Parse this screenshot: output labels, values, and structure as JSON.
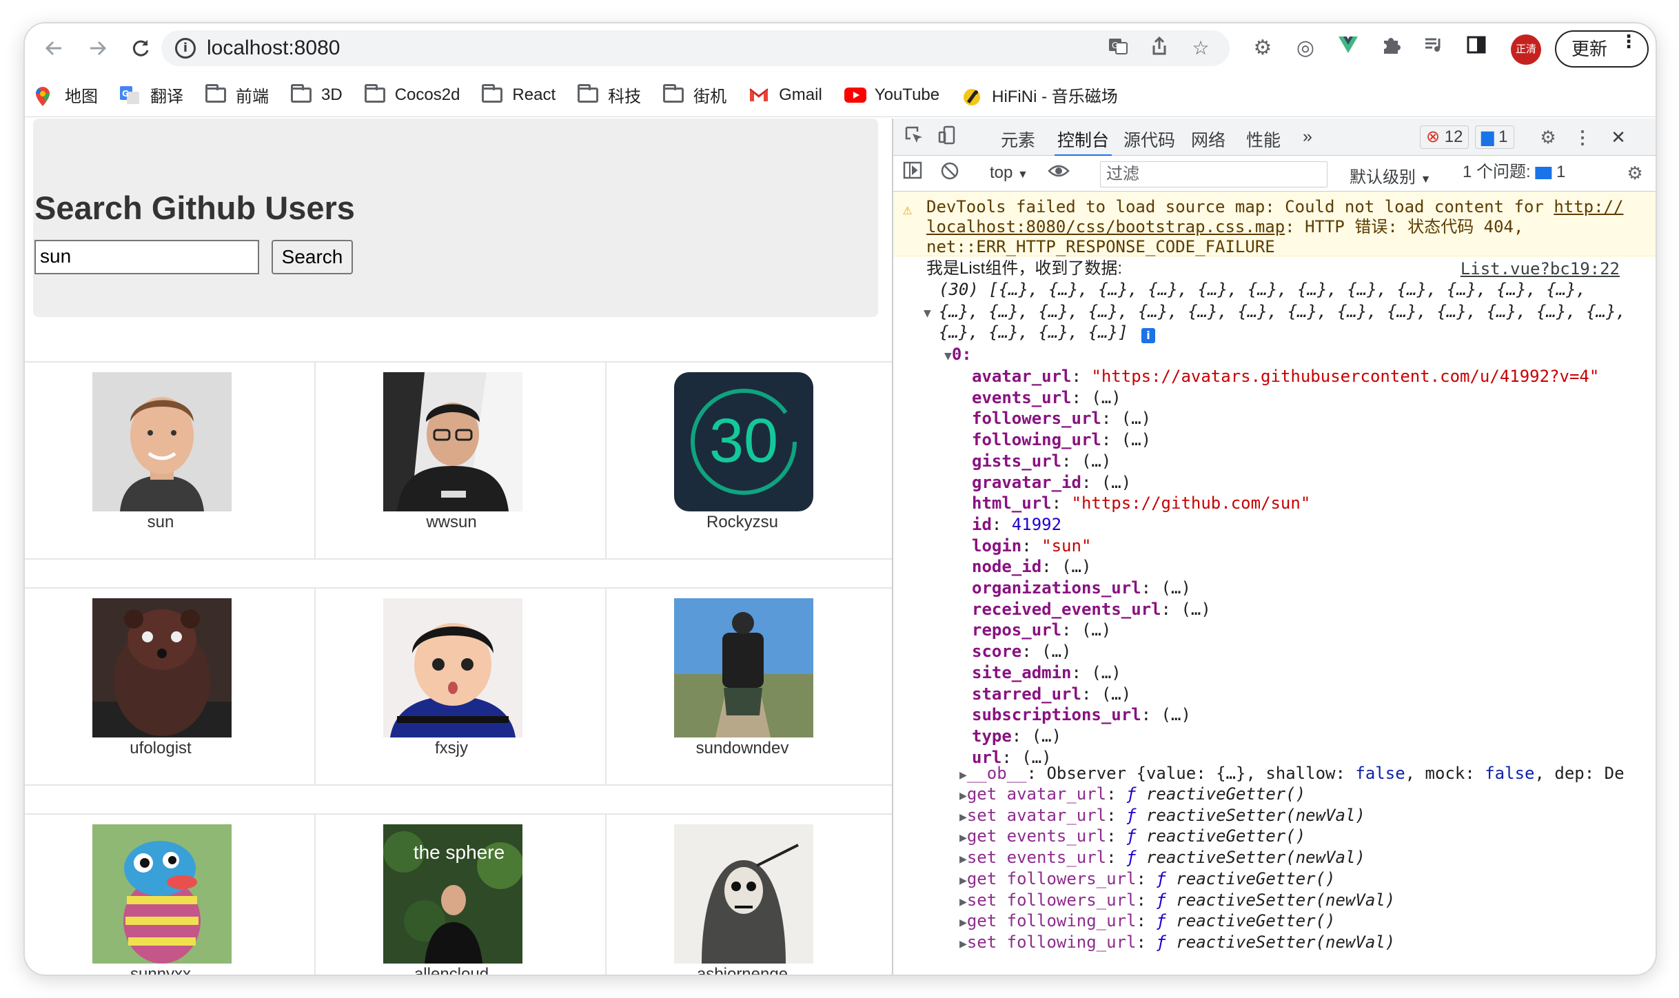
{
  "browser": {
    "url": "localhost:8080",
    "profile_label": "正清",
    "update_label": "更新"
  },
  "bookmarks": [
    {
      "label": "地图",
      "icon": "maps-icon"
    },
    {
      "label": "翻译",
      "icon": "translate-icon"
    },
    {
      "label": "前端",
      "icon": "folder-icon"
    },
    {
      "label": "3D",
      "icon": "folder-icon"
    },
    {
      "label": "Cocos2d",
      "icon": "folder-icon"
    },
    {
      "label": "React",
      "icon": "folder-icon"
    },
    {
      "label": "科技",
      "icon": "folder-icon"
    },
    {
      "label": "街机",
      "icon": "folder-icon"
    },
    {
      "label": "Gmail",
      "icon": "gmail-icon"
    },
    {
      "label": "YouTube",
      "icon": "youtube-icon"
    },
    {
      "label": "HiFiNi - 音乐磁场",
      "icon": "hifini-icon"
    }
  ],
  "app": {
    "title": "Search Github Users",
    "search_value": "sun",
    "search_button": "Search",
    "users": [
      {
        "login": "sun"
      },
      {
        "login": "wwsun"
      },
      {
        "login": "Rockyzsu",
        "avatar_text": "30"
      },
      {
        "login": "ufologist"
      },
      {
        "login": "fxsjy"
      },
      {
        "login": "sundowndev"
      },
      {
        "login": "sunnyxx"
      },
      {
        "login": "allencloud",
        "avatar_text": "the sphere"
      },
      {
        "login": "asbjornenge"
      }
    ]
  },
  "devtools": {
    "tabs": [
      "元素",
      "控制台",
      "源代码",
      "网络",
      "性能"
    ],
    "more_tabs": "»",
    "error_count": "12",
    "message_count": "1",
    "context": "top",
    "filter_placeholder": "过滤",
    "level": "默认级别",
    "issues": "1 个问题:",
    "issues_count": "1",
    "warning": {
      "prefix": "DevTools failed to load source map: Could not load content for ",
      "link1": "http://",
      "link2": "localhost:8080/css/bootstrap.css.map",
      "suffix": ": HTTP 错误: 状态代码 404,",
      "line3": "net::ERR_HTTP_RESPONSE_CODE_FAILURE"
    },
    "log": {
      "message": "我是List组件，收到了数据:",
      "source": "List.vue?bc19:22",
      "array_line1": "(30) [{…}, {…}, {…}, {…}, {…}, {…}, {…}, {…}, {…}, {…}, {…}, {…},",
      "array_line2": "{…}, {…}, {…}, {…}, {…}, {…}, {…}, {…}, {…}, {…}, {…}, {…}, {…}, {…},",
      "array_line3": "{…}, {…}, {…}, {…}]",
      "index_key": "0:"
    },
    "props": [
      {
        "key": "avatar_url",
        "value": "\"https://avatars.githubusercontent.com/u/41992?v=4\"",
        "kind": "str"
      },
      {
        "key": "events_url",
        "value": "(…)",
        "kind": "lazy"
      },
      {
        "key": "followers_url",
        "value": "(…)",
        "kind": "lazy"
      },
      {
        "key": "following_url",
        "value": "(…)",
        "kind": "lazy"
      },
      {
        "key": "gists_url",
        "value": "(…)",
        "kind": "lazy"
      },
      {
        "key": "gravatar_id",
        "value": "(…)",
        "kind": "lazy"
      },
      {
        "key": "html_url",
        "value": "\"https://github.com/sun\"",
        "kind": "str"
      },
      {
        "key": "id",
        "value": "41992",
        "kind": "num"
      },
      {
        "key": "login",
        "value": "\"sun\"",
        "kind": "str"
      },
      {
        "key": "node_id",
        "value": "(…)",
        "kind": "lazy"
      },
      {
        "key": "organizations_url",
        "value": "(…)",
        "kind": "lazy"
      },
      {
        "key": "received_events_url",
        "value": "(…)",
        "kind": "lazy"
      },
      {
        "key": "repos_url",
        "value": "(…)",
        "kind": "lazy"
      },
      {
        "key": "score",
        "value": "(…)",
        "kind": "lazy"
      },
      {
        "key": "site_admin",
        "value": "(…)",
        "kind": "lazy"
      },
      {
        "key": "starred_url",
        "value": "(…)",
        "kind": "lazy"
      },
      {
        "key": "subscriptions_url",
        "value": "(…)",
        "kind": "lazy"
      },
      {
        "key": "type",
        "value": "(…)",
        "kind": "lazy"
      },
      {
        "key": "url",
        "value": "(…)",
        "kind": "lazy"
      }
    ],
    "ob_line": {
      "key": "__ob__",
      "value": "Observer {value: {…}, shallow: ",
      "f1": "false",
      "mid": ", mock: ",
      "f2": "false",
      "tail": ", dep: De"
    },
    "accessors": [
      {
        "key": "get avatar_url",
        "fn": "reactiveGetter()"
      },
      {
        "key": "set avatar_url",
        "fn": "reactiveSetter(newVal)"
      },
      {
        "key": "get events_url",
        "fn": "reactiveGetter()"
      },
      {
        "key": "set events_url",
        "fn": "reactiveSetter(newVal)"
      },
      {
        "key": "get followers_url",
        "fn": "reactiveGetter()"
      },
      {
        "key": "set followers_url",
        "fn": "reactiveSetter(newVal)"
      },
      {
        "key": "get following_url",
        "fn": "reactiveGetter()"
      },
      {
        "key": "set following_url",
        "fn": "reactiveSetter(newVal)"
      }
    ]
  }
}
